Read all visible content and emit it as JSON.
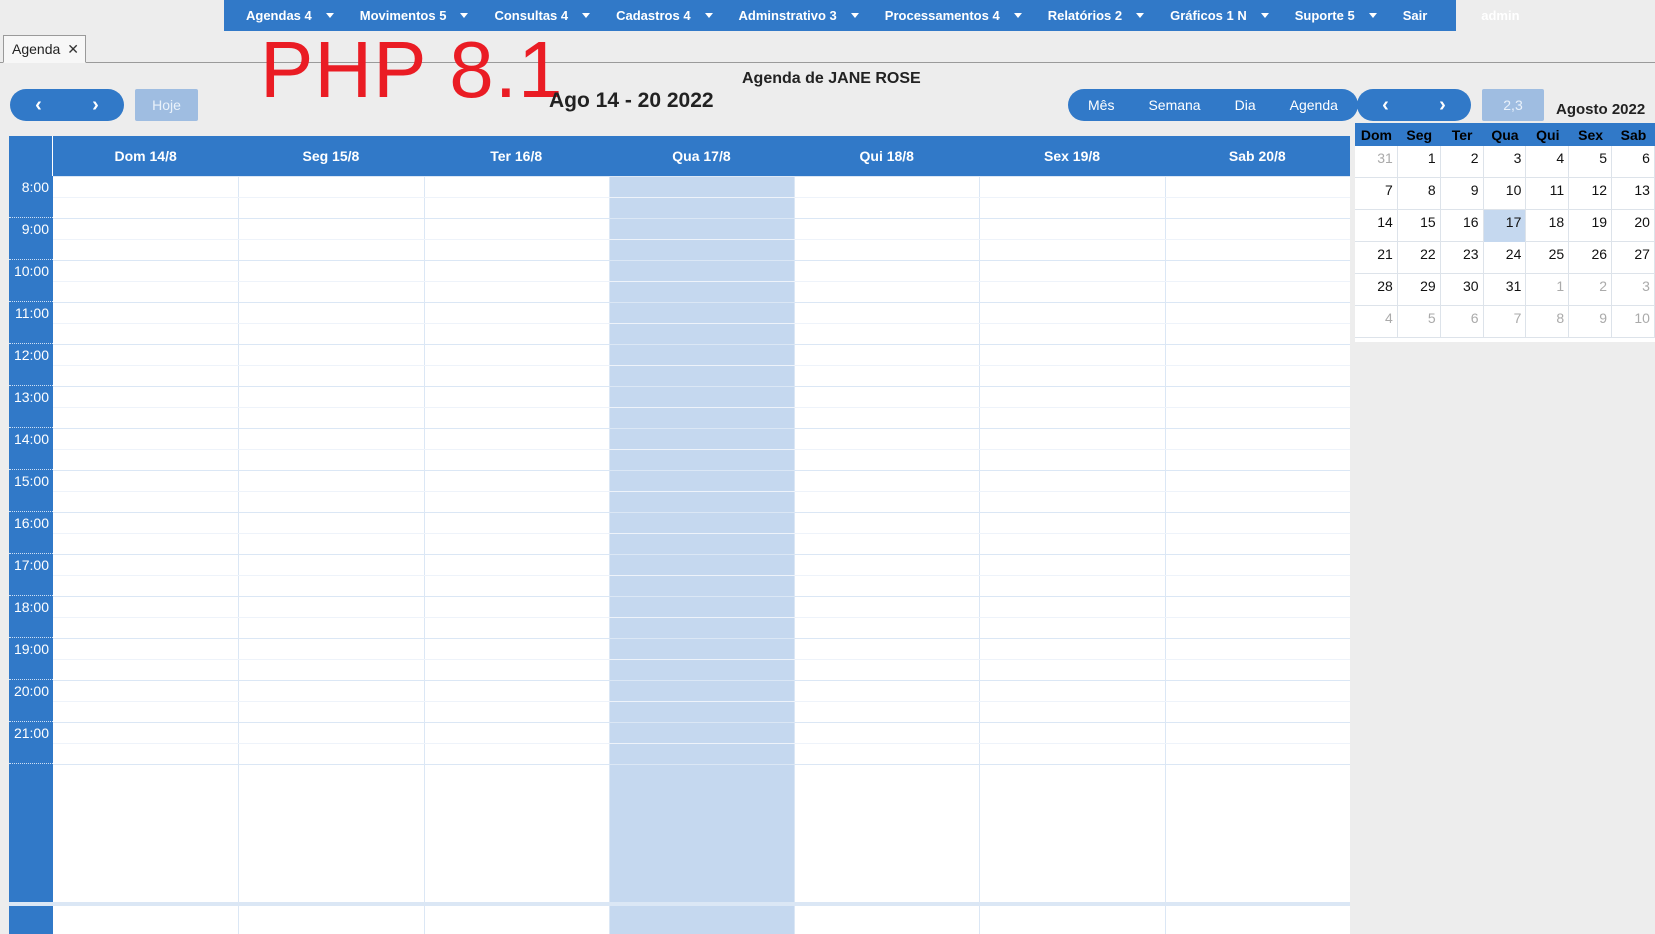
{
  "menu": [
    {
      "label": "Agendas 4",
      "dropdown": true
    },
    {
      "label": "Movimentos 5",
      "dropdown": true
    },
    {
      "label": "Consultas 4",
      "dropdown": true
    },
    {
      "label": "Cadastros 4",
      "dropdown": true
    },
    {
      "label": "Adminstrativo 3",
      "dropdown": true
    },
    {
      "label": "Processamentos 4",
      "dropdown": true
    },
    {
      "label": "Relatórios 2",
      "dropdown": true
    },
    {
      "label": "Gráficos 1 N",
      "dropdown": true
    },
    {
      "label": "Suporte 5",
      "dropdown": true
    },
    {
      "label": "Sair",
      "dropdown": false
    },
    {
      "label": "admin",
      "dropdown": false
    }
  ],
  "tab": {
    "label": "Agenda",
    "close": "✕"
  },
  "watermark": "PHP 8.1",
  "header": {
    "range_title": "Ago 14 - 20 2022",
    "agenda_title": "Agenda de JANE ROSE",
    "prev": "‹",
    "next": "›",
    "today": "Hoje",
    "views": [
      "Mês",
      "Semana",
      "Dia",
      "Agenda"
    ]
  },
  "week": {
    "days": [
      "Dom 14/8",
      "Seg 15/8",
      "Ter 16/8",
      "Qua 17/8",
      "Qui 18/8",
      "Sex 19/8",
      "Sab 20/8"
    ],
    "today_index": 3,
    "hours": [
      "8:00",
      "9:00",
      "10:00",
      "11:00",
      "12:00",
      "13:00",
      "14:00",
      "15:00",
      "16:00",
      "17:00",
      "18:00",
      "19:00",
      "20:00",
      "21:00"
    ]
  },
  "mini": {
    "title": "Agosto 2022",
    "prev": "‹",
    "next": "›",
    "today": [
      2,
      3
    ],
    "weekdays": [
      "Dom",
      "Seg",
      "Ter",
      "Qua",
      "Qui",
      "Sex",
      "Sab"
    ],
    "weeks": [
      [
        "31",
        "1",
        "2",
        "3",
        "4",
        "5",
        "6"
      ],
      [
        "7",
        "8",
        "9",
        "10",
        "11",
        "12",
        "13"
      ],
      [
        "14",
        "15",
        "16",
        "17",
        "18",
        "19",
        "20"
      ],
      [
        "21",
        "22",
        "23",
        "24",
        "25",
        "26",
        "27"
      ],
      [
        "28",
        "29",
        "30",
        "31",
        "1",
        "2",
        "3"
      ],
      [
        "4",
        "5",
        "6",
        "7",
        "8",
        "9",
        "10"
      ]
    ],
    "other_month": [
      [
        0,
        0
      ],
      [
        4,
        4
      ],
      [
        4,
        5
      ],
      [
        4,
        6
      ],
      [
        5,
        0
      ],
      [
        5,
        1
      ],
      [
        5,
        2
      ],
      [
        5,
        3
      ],
      [
        5,
        4
      ],
      [
        5,
        5
      ],
      [
        5,
        6
      ]
    ]
  }
}
